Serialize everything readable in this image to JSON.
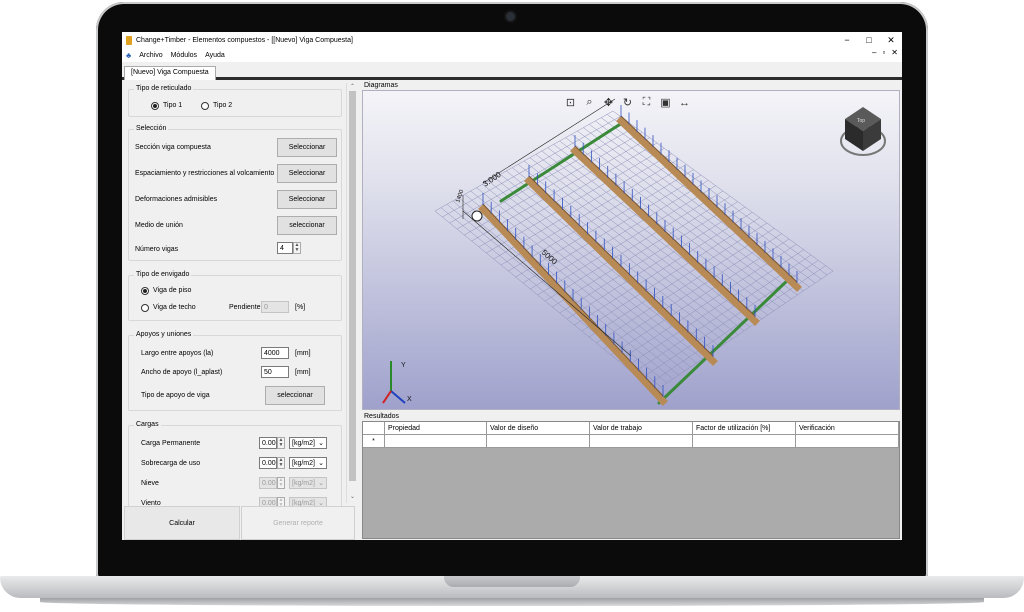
{
  "window": {
    "title": "Change+Timber - Elementos compuestos - [[Nuevo] Viga Compuesta]",
    "min_glyph": "−",
    "max_glyph": "□",
    "close_glyph": "✕"
  },
  "menu": {
    "items": [
      "Archivo",
      "Módulos",
      "Ayuda"
    ],
    "mdi_min": "–",
    "mdi_restore": "▫",
    "mdi_close": "✕"
  },
  "document_tab": "[Nuevo] Viga Compuesta",
  "tipo_reticulado": {
    "title": "Tipo de reticulado",
    "tipo1": "Tipo 1",
    "tipo2": "Tipo 2",
    "selected": "tipo1"
  },
  "seleccion": {
    "title": "Selección",
    "rows": [
      {
        "label": "Sección viga compuesta",
        "button": "Seleccionar"
      },
      {
        "label": "Espaciamiento y restricciones al volcamiento",
        "button": "Seleccionar"
      },
      {
        "label": "Deformaciones admisibles",
        "button": "Seleccionar"
      },
      {
        "label": "Medio de unión",
        "button": "seleccionar"
      }
    ],
    "numero_vigas_label": "Número vigas",
    "numero_vigas_value": "4"
  },
  "tipo_envigado": {
    "title": "Tipo de envigado",
    "viga_piso": "Viga de piso",
    "viga_techo": "Viga de techo",
    "pendiente_label": "Pendiente",
    "pendiente_value": "0",
    "pendiente_unit": "[%]"
  },
  "apoyos": {
    "title": "Apoyos y uniones",
    "largo_label": "Largo entre apoyos (la)",
    "largo_value": "4000",
    "largo_unit": "[mm]",
    "ancho_label": "Ancho de apoyo (l_aplast)",
    "ancho_value": "50",
    "ancho_unit": "[mm]",
    "tipo_label": "Tipo de apoyo de viga",
    "tipo_button": "seleccionar"
  },
  "cargas": {
    "title": "Cargas",
    "rows": [
      {
        "label": "Carga Permanente",
        "value": "0.00",
        "unit": "[kg/m2]"
      },
      {
        "label": "Sobrecarga de uso",
        "value": "0.00",
        "unit": "[kg/m2]"
      },
      {
        "label": "Nieve",
        "value": "0.00",
        "unit": "[kg/m2]"
      },
      {
        "label": "Viento",
        "value": "0.00",
        "unit": "[kg/m2]"
      }
    ]
  },
  "actions": {
    "calcular": "Calcular",
    "generar": "Generar reporte"
  },
  "diagramas": {
    "label": "Diagramas",
    "dim_span": "5000",
    "dim_width": "3.000",
    "dim_small": "1400",
    "axis_y": "Y",
    "axis_x": "X",
    "cube_label": "Top"
  },
  "resultados": {
    "label": "Resultados",
    "columns": [
      "Propiedad",
      "Valor de diseño",
      "Valor de trabajo",
      "Factor de utilización [%]",
      "Verificación"
    ],
    "new_row_marker": "*"
  },
  "colors": {
    "wood": "#b88a56",
    "grid": "#8d8fb8",
    "edge_green": "#3a8a3a",
    "load_arrow": "#3050c0"
  }
}
